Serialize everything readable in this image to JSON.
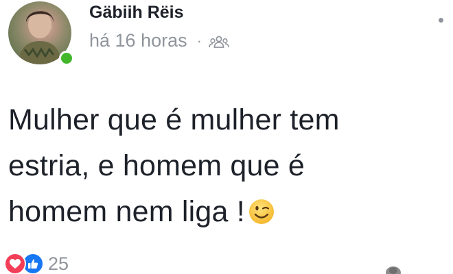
{
  "post": {
    "author_name": "Gäbiih Rëis",
    "timestamp": "há 16 horas",
    "separator": "·",
    "audience_icon": "friends-icon",
    "text_lines": [
      "Mulher que é mulher tem",
      "estria, e homem que é",
      "homem nem liga !"
    ],
    "emoji": "wink-emoji",
    "online": true
  },
  "reactions": {
    "types": [
      "love",
      "like"
    ],
    "count": "25"
  },
  "colors": {
    "text": "#1d2129",
    "meta": "#90949c",
    "online": "#42b72a",
    "love": "#f33e58",
    "like": "#1877f2"
  }
}
